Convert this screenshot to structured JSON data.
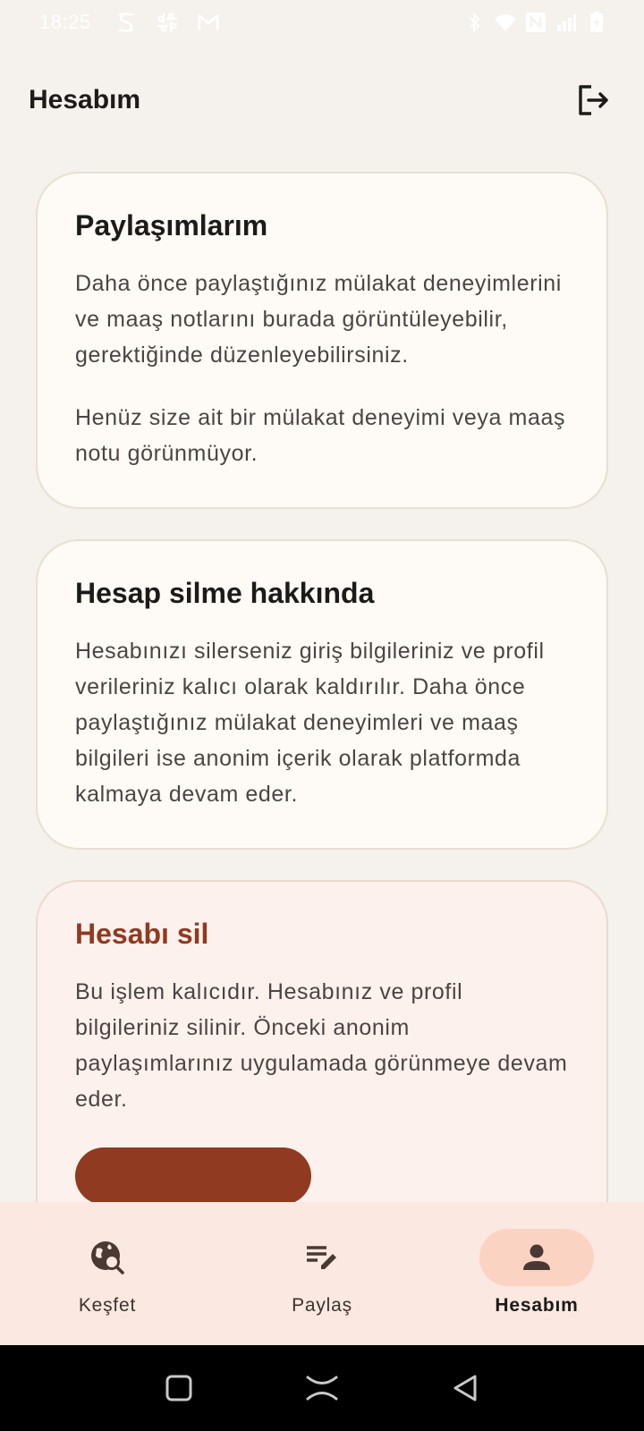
{
  "status_bar": {
    "time": "18:25",
    "left_icons": [
      "s-app-icon",
      "slack-icon",
      "gmail-icon"
    ],
    "right_icons": [
      "bluetooth-icon",
      "wifi-icon",
      "nfc-icon",
      "signal-icon",
      "battery-icon"
    ]
  },
  "app_bar": {
    "title": "Hesabım",
    "logout_icon": "logout-icon"
  },
  "cards": {
    "shares": {
      "title": "Paylaşımlarım",
      "description": "Daha önce paylaştığınız mülakat deneyimlerini ve maaş notlarını burada görüntüleyebilir, gerektiğinde düzenleyebilirsiniz.",
      "empty_state": "Henüz size ait bir mülakat deneyimi veya maaş notu görünmüyor."
    },
    "about_delete": {
      "title": "Hesap silme hakkında",
      "description": "Hesabınızı silerseniz giriş bilgileriniz ve profil verileriniz kalıcı olarak kaldırılır. Daha önce paylaştığınız mülakat deneyimleri ve maaş bilgileri ise anonim içerik olarak platformda kalmaya devam eder."
    },
    "delete_account": {
      "title": "Hesabı sil",
      "description": "Bu işlem kalıcıdır. Hesabınız ve profil bilgileriniz silinir. Önceki anonim paylaşımlarınız uygulamada görünmeye devam eder."
    }
  },
  "bottom_nav": {
    "items": [
      {
        "label": "Keşfet",
        "icon": "travel-explore-icon",
        "active": false
      },
      {
        "label": "Paylaş",
        "icon": "edit-note-icon",
        "active": false
      },
      {
        "label": "Hesabım",
        "icon": "person-icon",
        "active": true
      }
    ]
  },
  "colors": {
    "background": "#f5f1ec",
    "card": "#fefbf6",
    "danger_card": "#fdf1ed",
    "danger_accent": "#8f3a21",
    "nav_background": "#fbe8e1",
    "nav_active_pill": "#fbd3c3"
  }
}
